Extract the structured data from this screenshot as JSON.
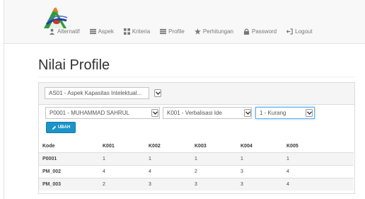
{
  "nav": {
    "items": [
      {
        "label": "Alternatif",
        "icon": "user-icon"
      },
      {
        "label": "Aspek",
        "icon": "list-icon"
      },
      {
        "label": "Kriteria",
        "icon": "grid-icon"
      },
      {
        "label": "Profile",
        "icon": "list-icon"
      },
      {
        "label": "Perhitungan",
        "icon": "star-icon"
      },
      {
        "label": "Password",
        "icon": "lock-icon"
      },
      {
        "label": "Logout",
        "icon": "logout-icon"
      }
    ]
  },
  "page": {
    "title": "Nilai Profile"
  },
  "filters": {
    "aspek": "AS01 - Aspek Kapasitas Intelektual...",
    "alternatif": "P0001 - MUHAMMAD SAHRUL",
    "kriteria": "K001 - Verbalisasi Ide",
    "nilai": "1 - Kurang",
    "ubah_label": "UBAH"
  },
  "table": {
    "headers": [
      "Kode",
      "K001",
      "K002",
      "K003",
      "K004",
      "K005"
    ],
    "rows": [
      [
        "P0001",
        "1",
        "1",
        "1",
        "1",
        "1"
      ],
      [
        "PM_002",
        "4",
        "4",
        "2",
        "3",
        "4"
      ],
      [
        "PM_003",
        "2",
        "3",
        "3",
        "3",
        "4"
      ]
    ]
  }
}
